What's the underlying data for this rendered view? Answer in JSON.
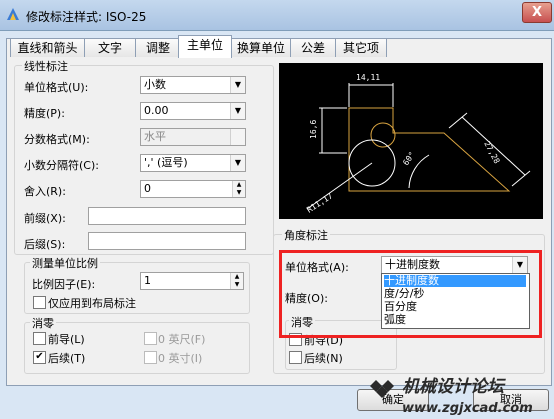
{
  "window": {
    "title": "修改标注样式: ISO-25",
    "close_label": "X"
  },
  "tabs": [
    "直线和箭头",
    "文字",
    "调整",
    "主单位",
    "换算单位",
    "公差",
    "其它项"
  ],
  "linear": {
    "group_title": "线性标注",
    "unit_format_label": "单位格式(U):",
    "unit_format_value": "小数",
    "precision_label": "精度(P):",
    "precision_value": "0.00",
    "fraction_label": "分数格式(M):",
    "fraction_value": "水平",
    "decimal_sep_label": "小数分隔符(C):",
    "decimal_sep_value": "','  (逗号)",
    "round_label": "舍入(R):",
    "round_value": "0",
    "prefix_label": "前缀(X):",
    "suffix_label": "后缀(S):"
  },
  "scale": {
    "group_title": "测量单位比例",
    "factor_label": "比例因子(E):",
    "factor_value": "1",
    "layout_only_label": "仅应用到布局标注"
  },
  "zero_left": {
    "group_title": "消零",
    "leading_label": "前导(L)",
    "trailing_label": "后续(T)",
    "feet_label": "0 英尺(F)",
    "inches_label": "0 英寸(I)"
  },
  "preview": {
    "dim_top": "14,11",
    "dim_left": "16,6",
    "dim_right": "27,28",
    "dim_angle": "60°",
    "dim_radius": "R11,17"
  },
  "angular": {
    "group_title": "角度标注",
    "unit_format_label": "单位格式(A):",
    "unit_format_value": "十进制度数",
    "precision_label": "精度(O):",
    "zero_title": "消零",
    "leading_label": "前导(D)",
    "trailing_label": "后续(N)"
  },
  "dropdown_options": [
    "十进制度数",
    "度/分/秒",
    "百分度",
    "弧度"
  ],
  "buttons": {
    "ok": "确定",
    "cancel": "取消"
  },
  "watermark": {
    "text": "机械设计论坛",
    "url": "www.zgjxcad.com"
  },
  "colors": {
    "highlight_box": "#ee2222",
    "preview_geometry": "#d9a441",
    "selection": "#3399ff"
  }
}
